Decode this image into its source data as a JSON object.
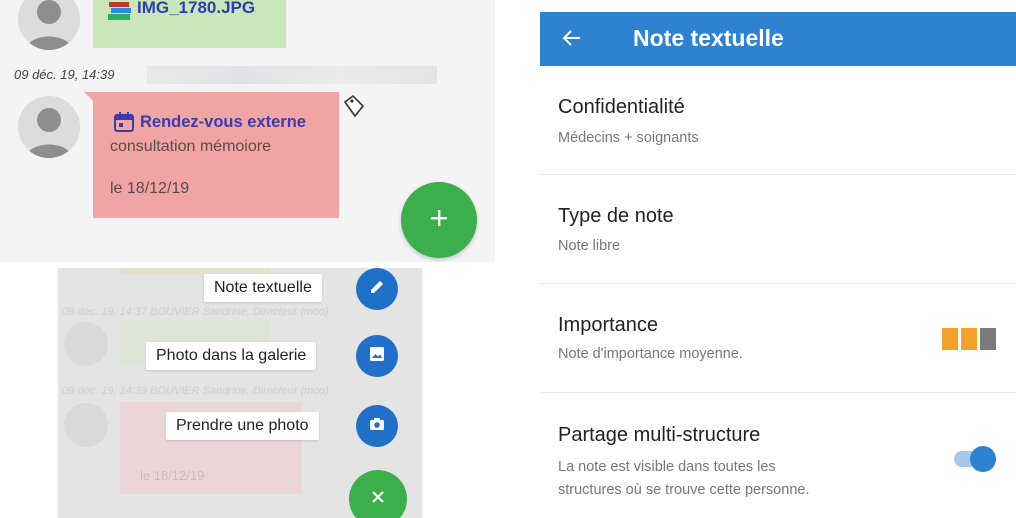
{
  "chat": {
    "attachment_name": "IMG_1780.JPG",
    "timestamp": "09 déc. 19, 14:39",
    "event_title": "Rendez-vous externe",
    "event_desc": "consultation mémoiore",
    "event_date": "le 18/12/19",
    "fab_icon": "plus-icon"
  },
  "menu": {
    "items": [
      {
        "label": "Note textuelle",
        "icon": "pencil-icon"
      },
      {
        "label": "Photo dans la galerie",
        "icon": "image-icon"
      },
      {
        "label": "Prendre une photo",
        "icon": "camera-icon"
      }
    ],
    "close_icon": "close-icon",
    "ghost_lines": [
      "09 déc. 19, 14:37 BOUVIER Sandrine, Directeur (mco)",
      "09 déc. 19, 14:39 BOUVIER Sandrine, Directeur (mco)",
      "le 18/12/19"
    ]
  },
  "note": {
    "title": "Note textuelle",
    "back_icon": "arrow-left-icon",
    "rows": [
      {
        "title": "Confidentialité",
        "sub": "Médecins + soignants"
      },
      {
        "title": "Type de note",
        "sub": "Note libre"
      },
      {
        "title": "Importance",
        "sub": "Note d'importance moyenne."
      },
      {
        "title": "Partage multi-structure",
        "sub1": "La note est visible dans toutes les",
        "sub2": "structures où se trouve cette personne."
      }
    ],
    "importance_level": 2,
    "importance_max": 3,
    "share_enabled": true
  },
  "colors": {
    "appbar": "#2f82d0",
    "fab_green": "#3cae4b",
    "mini_fab_blue": "#1f70c6",
    "importance_on": "#f2a12b",
    "importance_off": "#7a7a7a",
    "toggle_on": "#2f82d0",
    "event_title": "#3b3bb0"
  }
}
